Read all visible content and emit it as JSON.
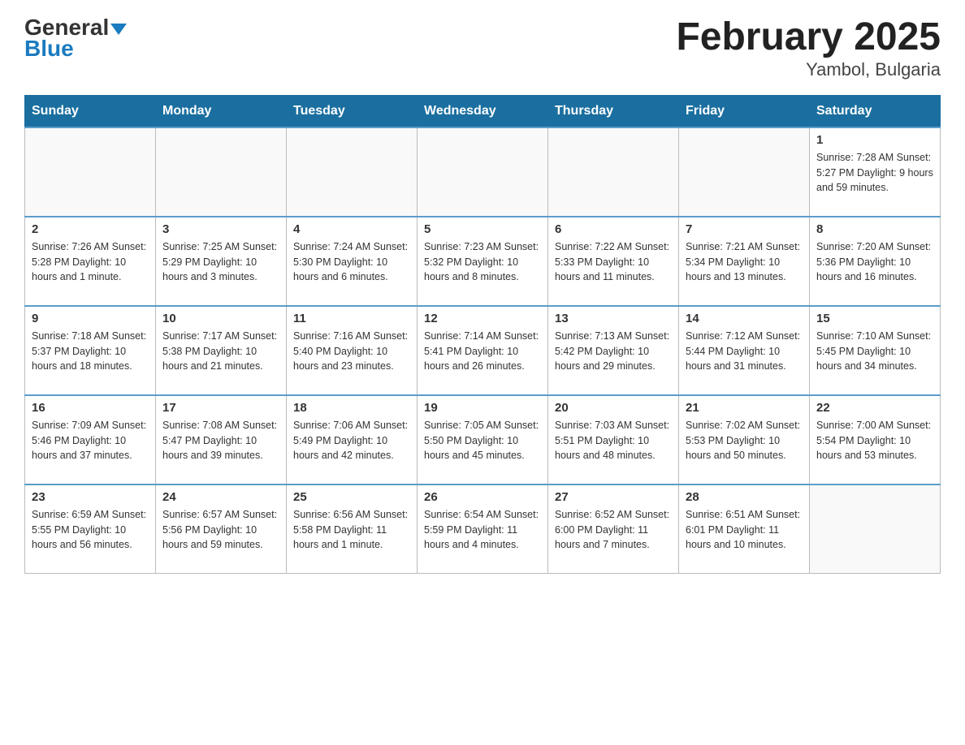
{
  "logo": {
    "general": "General",
    "blue": "Blue"
  },
  "title": "February 2025",
  "subtitle": "Yambol, Bulgaria",
  "weekdays": [
    "Sunday",
    "Monday",
    "Tuesday",
    "Wednesday",
    "Thursday",
    "Friday",
    "Saturday"
  ],
  "weeks": [
    [
      {
        "day": "",
        "info": ""
      },
      {
        "day": "",
        "info": ""
      },
      {
        "day": "",
        "info": ""
      },
      {
        "day": "",
        "info": ""
      },
      {
        "day": "",
        "info": ""
      },
      {
        "day": "",
        "info": ""
      },
      {
        "day": "1",
        "info": "Sunrise: 7:28 AM\nSunset: 5:27 PM\nDaylight: 9 hours and 59 minutes."
      }
    ],
    [
      {
        "day": "2",
        "info": "Sunrise: 7:26 AM\nSunset: 5:28 PM\nDaylight: 10 hours and 1 minute."
      },
      {
        "day": "3",
        "info": "Sunrise: 7:25 AM\nSunset: 5:29 PM\nDaylight: 10 hours and 3 minutes."
      },
      {
        "day": "4",
        "info": "Sunrise: 7:24 AM\nSunset: 5:30 PM\nDaylight: 10 hours and 6 minutes."
      },
      {
        "day": "5",
        "info": "Sunrise: 7:23 AM\nSunset: 5:32 PM\nDaylight: 10 hours and 8 minutes."
      },
      {
        "day": "6",
        "info": "Sunrise: 7:22 AM\nSunset: 5:33 PM\nDaylight: 10 hours and 11 minutes."
      },
      {
        "day": "7",
        "info": "Sunrise: 7:21 AM\nSunset: 5:34 PM\nDaylight: 10 hours and 13 minutes."
      },
      {
        "day": "8",
        "info": "Sunrise: 7:20 AM\nSunset: 5:36 PM\nDaylight: 10 hours and 16 minutes."
      }
    ],
    [
      {
        "day": "9",
        "info": "Sunrise: 7:18 AM\nSunset: 5:37 PM\nDaylight: 10 hours and 18 minutes."
      },
      {
        "day": "10",
        "info": "Sunrise: 7:17 AM\nSunset: 5:38 PM\nDaylight: 10 hours and 21 minutes."
      },
      {
        "day": "11",
        "info": "Sunrise: 7:16 AM\nSunset: 5:40 PM\nDaylight: 10 hours and 23 minutes."
      },
      {
        "day": "12",
        "info": "Sunrise: 7:14 AM\nSunset: 5:41 PM\nDaylight: 10 hours and 26 minutes."
      },
      {
        "day": "13",
        "info": "Sunrise: 7:13 AM\nSunset: 5:42 PM\nDaylight: 10 hours and 29 minutes."
      },
      {
        "day": "14",
        "info": "Sunrise: 7:12 AM\nSunset: 5:44 PM\nDaylight: 10 hours and 31 minutes."
      },
      {
        "day": "15",
        "info": "Sunrise: 7:10 AM\nSunset: 5:45 PM\nDaylight: 10 hours and 34 minutes."
      }
    ],
    [
      {
        "day": "16",
        "info": "Sunrise: 7:09 AM\nSunset: 5:46 PM\nDaylight: 10 hours and 37 minutes."
      },
      {
        "day": "17",
        "info": "Sunrise: 7:08 AM\nSunset: 5:47 PM\nDaylight: 10 hours and 39 minutes."
      },
      {
        "day": "18",
        "info": "Sunrise: 7:06 AM\nSunset: 5:49 PM\nDaylight: 10 hours and 42 minutes."
      },
      {
        "day": "19",
        "info": "Sunrise: 7:05 AM\nSunset: 5:50 PM\nDaylight: 10 hours and 45 minutes."
      },
      {
        "day": "20",
        "info": "Sunrise: 7:03 AM\nSunset: 5:51 PM\nDaylight: 10 hours and 48 minutes."
      },
      {
        "day": "21",
        "info": "Sunrise: 7:02 AM\nSunset: 5:53 PM\nDaylight: 10 hours and 50 minutes."
      },
      {
        "day": "22",
        "info": "Sunrise: 7:00 AM\nSunset: 5:54 PM\nDaylight: 10 hours and 53 minutes."
      }
    ],
    [
      {
        "day": "23",
        "info": "Sunrise: 6:59 AM\nSunset: 5:55 PM\nDaylight: 10 hours and 56 minutes."
      },
      {
        "day": "24",
        "info": "Sunrise: 6:57 AM\nSunset: 5:56 PM\nDaylight: 10 hours and 59 minutes."
      },
      {
        "day": "25",
        "info": "Sunrise: 6:56 AM\nSunset: 5:58 PM\nDaylight: 11 hours and 1 minute."
      },
      {
        "day": "26",
        "info": "Sunrise: 6:54 AM\nSunset: 5:59 PM\nDaylight: 11 hours and 4 minutes."
      },
      {
        "day": "27",
        "info": "Sunrise: 6:52 AM\nSunset: 6:00 PM\nDaylight: 11 hours and 7 minutes."
      },
      {
        "day": "28",
        "info": "Sunrise: 6:51 AM\nSunset: 6:01 PM\nDaylight: 11 hours and 10 minutes."
      },
      {
        "day": "",
        "info": ""
      }
    ]
  ]
}
